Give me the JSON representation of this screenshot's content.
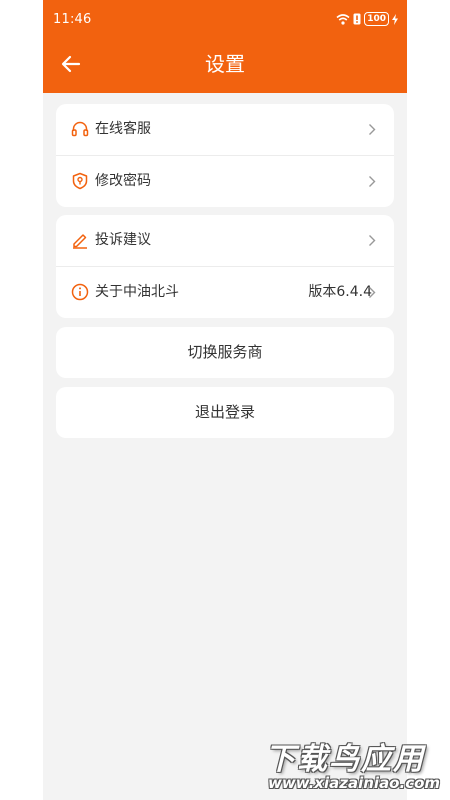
{
  "status_bar": {
    "time": "11:46",
    "battery": "100"
  },
  "header": {
    "title": "设置"
  },
  "group1": [
    {
      "label": "在线客服",
      "icon": "headset-icon"
    },
    {
      "label": "修改密码",
      "icon": "shield-key-icon"
    }
  ],
  "group2": [
    {
      "label": "投诉建议",
      "icon": "pencil-icon"
    },
    {
      "label": "关于中油北斗",
      "icon": "info-icon",
      "value": "版本6.4.4"
    }
  ],
  "actions": {
    "switch_provider": "切换服务商",
    "logout": "退出登录"
  },
  "watermark": {
    "title": "下载鸟应用",
    "url": "www.xiazainiao.com"
  },
  "colors": {
    "accent": "#f2620f",
    "background": "#f3f3f3",
    "text": "#333333"
  }
}
